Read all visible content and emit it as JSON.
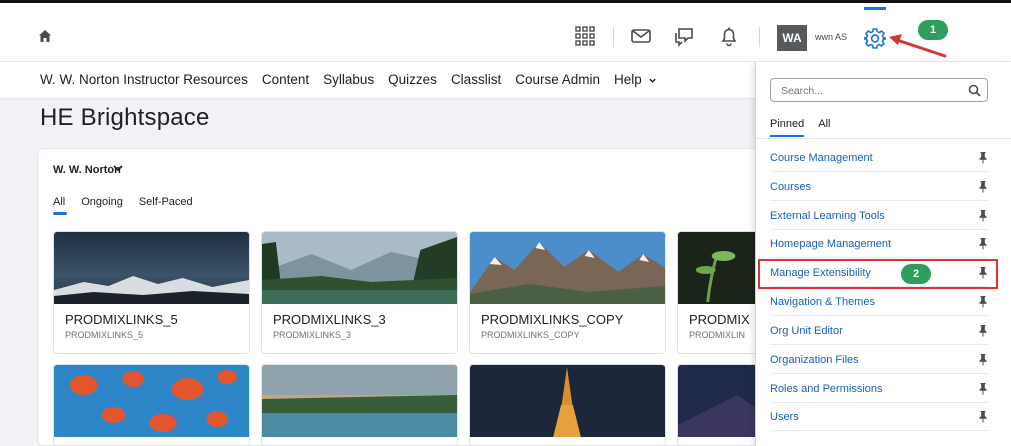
{
  "topbar": {
    "avatar_initials": "WA",
    "user_name": "wwn AS",
    "icons": [
      "home-icon",
      "apps-grid-icon",
      "mail-icon",
      "chat-icon",
      "bell-icon",
      "gear-icon"
    ]
  },
  "annotations": {
    "step1": "1",
    "step2": "2",
    "highlight_color": "#d93535",
    "badge_color": "#2e9e5e"
  },
  "nav": {
    "items": [
      "W. W. Norton Instructor Resources",
      "Content",
      "Syllabus",
      "Quizzes",
      "Classlist",
      "Course Admin",
      "Help"
    ]
  },
  "page": {
    "title": "HE Brightspace"
  },
  "widget": {
    "org_name": "W. W. Norton",
    "tabs": [
      "All",
      "Ongoing",
      "Self-Paced"
    ],
    "cards": [
      {
        "title": "PRODMIXLINKS_5",
        "code": "PRODMIXLINKS_5"
      },
      {
        "title": "PRODMIXLINKS_3",
        "code": "PRODMIXLINKS_3"
      },
      {
        "title": "PRODMIXLINKS_COPY",
        "code": "PRODMIXLINKS_COPY"
      },
      {
        "title": "PRODMIX",
        "code": "PRODMIXLIN"
      }
    ]
  },
  "dropdown": {
    "search_placeholder": "Search...",
    "tabs": [
      "Pinned",
      "All"
    ],
    "items": [
      "Course Management",
      "Courses",
      "External Learning Tools",
      "Homepage Management",
      "Manage Extensibility",
      "Navigation & Themes",
      "Org Unit Editor",
      "Organization Files",
      "Roles and Permissions",
      "Users"
    ]
  },
  "colors": {
    "accent": "#1a73d9",
    "link": "#1a5fb4"
  }
}
